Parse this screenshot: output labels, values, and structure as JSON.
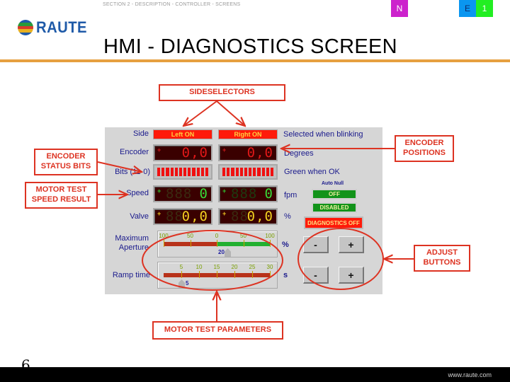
{
  "header": {
    "section": "SECTION 2 - DESCRIPTION - CONTROLLER - SCREENS",
    "badges": {
      "n": "N",
      "e": "E",
      "one": "1"
    },
    "logo_text": "RAUTE",
    "title": "HMI - DIAGNOSTICS SCREEN",
    "colors": {
      "rule": "#e6a040",
      "badge_n": "#cc22cc",
      "badge_e": "#0a96f0",
      "badge_1": "#22ee22"
    }
  },
  "hmi": {
    "rows": {
      "side": "Side",
      "encoder": "Encoder",
      "bits": "Bits (11-0)",
      "speed": "Speed",
      "valve": "Valve",
      "max_aperture_1": "Maximum",
      "max_aperture_2": "Aperture",
      "ramp_time": "Ramp time"
    },
    "side_buttons": {
      "left": "Left ON",
      "right": "Right ON"
    },
    "encoder": {
      "left_sign": "+",
      "left_value": "0,0",
      "right_sign": "+",
      "right_value": "0,0"
    },
    "speed": {
      "left_sign": "+",
      "left_ghost": "888",
      "left_value": "0",
      "right_sign": "+",
      "right_ghost": "888",
      "right_value": "0"
    },
    "valve": {
      "left_sign": "+",
      "left_ghost": "88",
      "left_value": "0,0",
      "right_sign": "+",
      "right_ghost": "88",
      "right_value": "0,0"
    },
    "bits_count": 12,
    "notes": {
      "side": "Selected when blinking",
      "encoder": "Degrees",
      "bits": "Green when OK",
      "speed": "fpm",
      "valve": "%"
    },
    "auto_null": {
      "label": "Auto Null",
      "state": "OFF",
      "status": "DISABLED"
    },
    "diagnostics_button": "DIAGNOSTICS OFF",
    "aperture_slider": {
      "ticks": [
        "100",
        "50",
        "0",
        "50",
        "100"
      ],
      "value": "20",
      "unit": "%",
      "range": [
        -100,
        100
      ],
      "current": 20
    },
    "ramp_slider": {
      "ticks": [
        "5",
        "10",
        "15",
        "20",
        "25",
        "30"
      ],
      "value": "5",
      "unit": "s",
      "range": [
        0,
        30
      ],
      "current": 5
    },
    "adjust_buttons": {
      "minus": "-",
      "plus": "+"
    }
  },
  "callouts": {
    "sideselectors": "SIDESELECTORS",
    "encoder_status_bits_1": "ENCODER",
    "encoder_status_bits_2": "STATUS BITS",
    "motor_test_speed_1": "MOTOR TEST",
    "motor_test_speed_2": "SPEED RESULT",
    "encoder_positions_1": "ENCODER",
    "encoder_positions_2": "POSITIONS",
    "adjust_buttons_1": "ADJUST",
    "adjust_buttons_2": "BUTTONS",
    "motor_test_parameters": "MOTOR TEST PARAMETERS"
  },
  "footer": {
    "page_number": "6",
    "url": "www.raute.com"
  }
}
